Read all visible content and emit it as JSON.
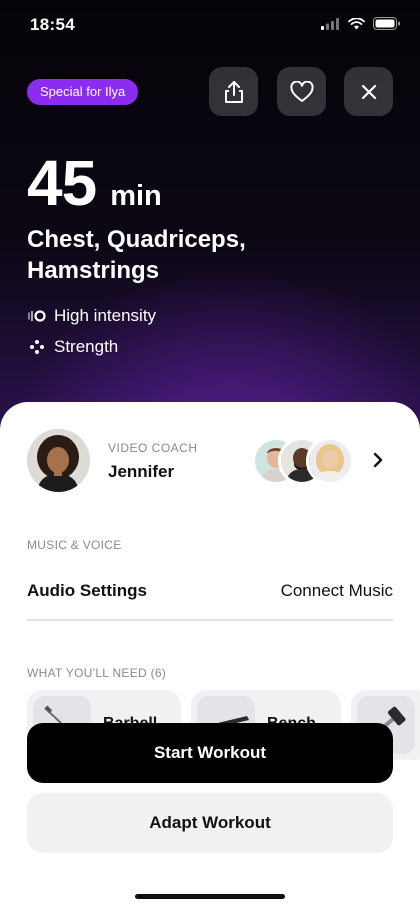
{
  "status_bar": {
    "time": "18:54"
  },
  "hero": {
    "badge": "Special for Ilya",
    "duration_value": "45",
    "duration_unit": "min",
    "muscles": "Chest, Quadriceps, Hamstrings",
    "tags": [
      {
        "icon": "intensity-icon",
        "label": "High intensity"
      },
      {
        "icon": "strength-icon",
        "label": "Strength"
      }
    ],
    "actions": [
      "share-icon",
      "heart-icon",
      "close-icon"
    ]
  },
  "coach": {
    "label": "VIDEO COACH",
    "name": "Jennifer"
  },
  "music_voice": {
    "section_label": "MUSIC & VOICE",
    "audio_settings": "Audio Settings",
    "connect_music": "Connect Music"
  },
  "equipment": {
    "section_label": "WHAT YOU'LL NEED (6)",
    "items": [
      {
        "label": "Barbell"
      },
      {
        "label": "Bench"
      },
      {
        "label": ""
      }
    ]
  },
  "buttons": {
    "start": "Start Workout",
    "adapt": "Adapt Workout"
  },
  "colors": {
    "badge": "#8b2cf0",
    "primary_button": "#000000",
    "secondary_button": "#f1f1f4"
  }
}
